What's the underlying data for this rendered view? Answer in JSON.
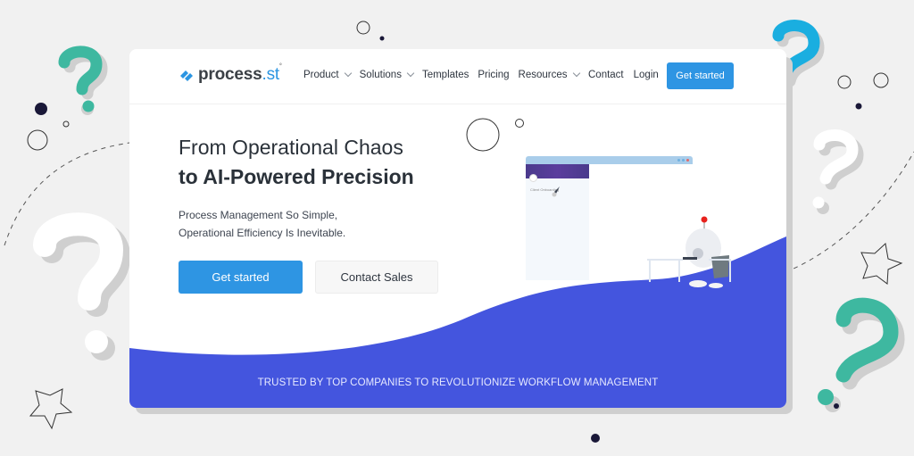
{
  "nav": {
    "logo": {
      "brand": "process",
      "suffix": ".st",
      "mark": "°"
    },
    "menu": [
      {
        "label": "Product",
        "has_dropdown": true
      },
      {
        "label": "Solutions",
        "has_dropdown": true
      },
      {
        "label": "Templates",
        "has_dropdown": false
      },
      {
        "label": "Pricing",
        "has_dropdown": false
      },
      {
        "label": "Resources",
        "has_dropdown": true
      }
    ],
    "right": [
      {
        "label": "Contact"
      },
      {
        "label": "Login"
      }
    ],
    "cta": "Get started"
  },
  "hero": {
    "title_line1": "From Operational Chaos",
    "title_line2": "to AI-Powered Precision",
    "subtitle_line1": "Process Management So Simple,",
    "subtitle_line2": "Operational Efficiency Is Inevitable.",
    "primary_button": "Get started",
    "secondary_button": "Contact Sales"
  },
  "illustration": {
    "mockup_label": "Client Onboarding"
  },
  "banner": {
    "text": "TRUSTED BY TOP COMPANIES TO REVOLUTIONIZE WORKFLOW MANAGEMENT"
  },
  "colors": {
    "accent": "#2e95e3",
    "wave": "#4455de",
    "teal": "#3eb8a0",
    "cyan": "#1aaee0",
    "dark_dot": "#1a1838",
    "background": "#f1f1f1"
  }
}
